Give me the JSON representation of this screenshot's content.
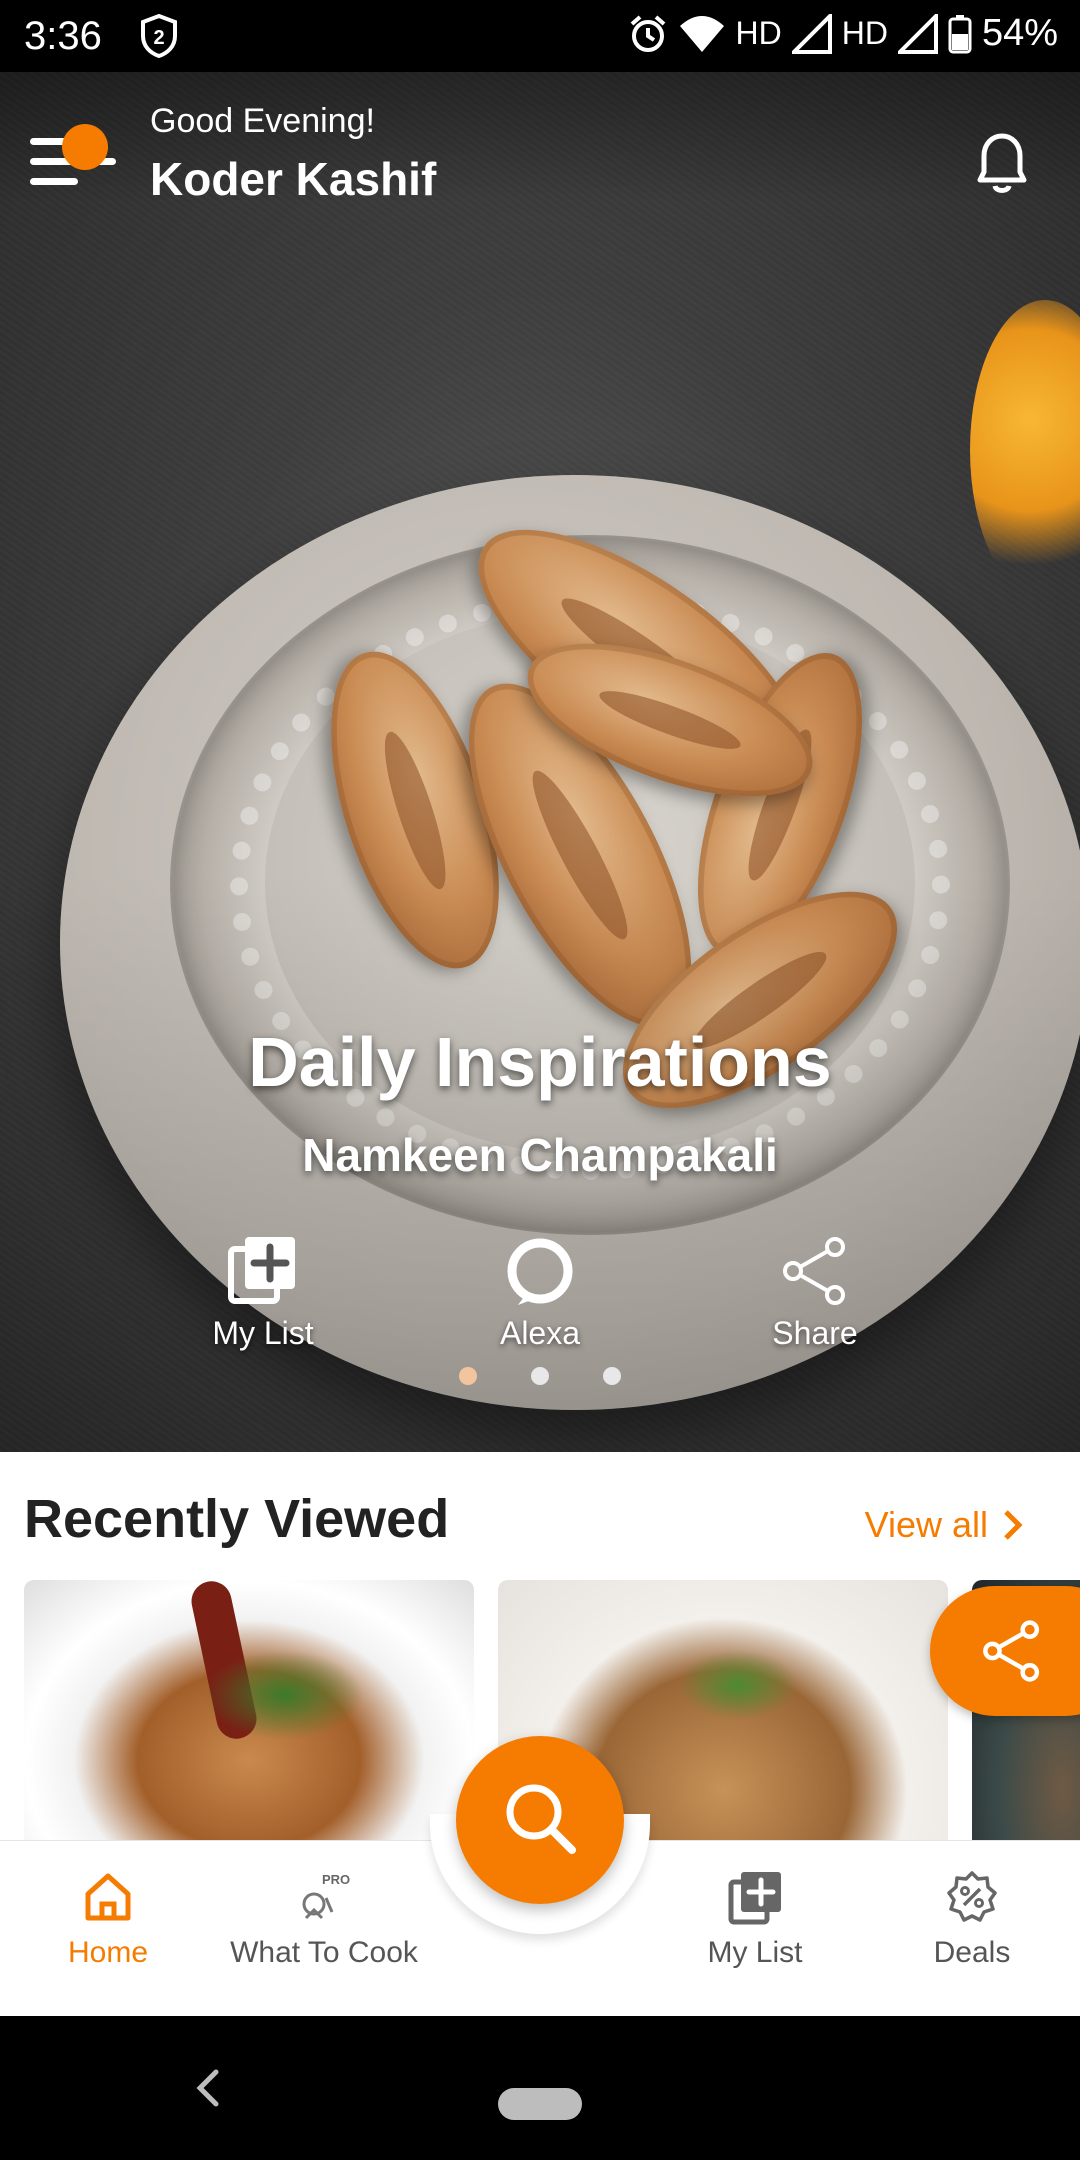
{
  "status_bar": {
    "time": "3:36",
    "network_label_1": "HD",
    "network_label_2": "HD",
    "battery": "54%"
  },
  "header": {
    "greeting": "Good Evening!",
    "user_name": "Koder Kashif"
  },
  "hero": {
    "title": "Daily Inspirations",
    "subtitle": "Namkeen Champakali",
    "actions": [
      {
        "label": "My List",
        "icon": "add-to-list-icon"
      },
      {
        "label": "Alexa",
        "icon": "alexa-icon"
      },
      {
        "label": "Share",
        "icon": "share-icon"
      }
    ],
    "carousel_total": 3,
    "carousel_active": 1
  },
  "recently_viewed": {
    "title": "Recently Viewed",
    "view_all": "View all"
  },
  "bottom_nav": {
    "items": [
      {
        "label": "Home",
        "icon": "home-icon",
        "active": true
      },
      {
        "label": "What To Cook",
        "icon": "what-to-cook-pro-icon",
        "badge": "PRO",
        "active": false
      },
      {
        "label": "My List",
        "icon": "my-list-icon",
        "active": false
      },
      {
        "label": "Deals",
        "icon": "deals-icon",
        "active": false
      }
    ]
  },
  "colors": {
    "accent": "#f57c00"
  }
}
